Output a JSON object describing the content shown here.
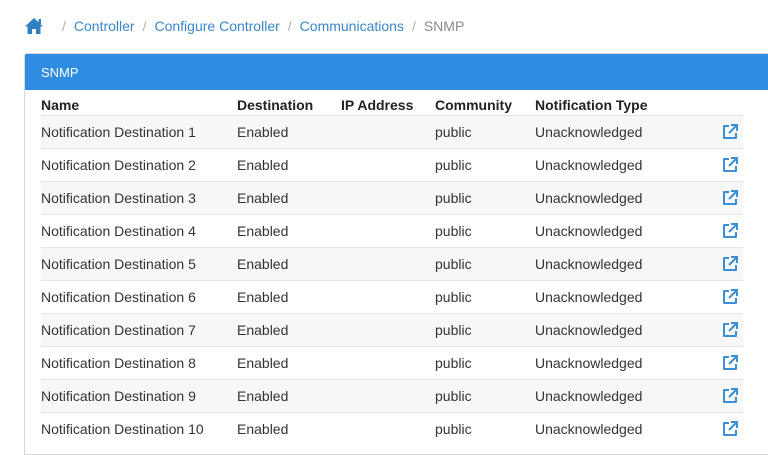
{
  "breadcrumb": {
    "home_icon": "home-icon",
    "items": [
      "Controller",
      "Configure Controller",
      "Communications"
    ],
    "current": "SNMP"
  },
  "panel": {
    "title": "SNMP"
  },
  "table": {
    "headers": [
      "Name",
      "Destination",
      "IP Address",
      "Community",
      "Notification Type"
    ],
    "rows": [
      {
        "name": "Notification Destination 1",
        "destination": "Enabled",
        "ip": "",
        "community": "public",
        "type": "Unacknowledged"
      },
      {
        "name": "Notification Destination 2",
        "destination": "Enabled",
        "ip": "",
        "community": "public",
        "type": "Unacknowledged"
      },
      {
        "name": "Notification Destination 3",
        "destination": "Enabled",
        "ip": "",
        "community": "public",
        "type": "Unacknowledged"
      },
      {
        "name": "Notification Destination 4",
        "destination": "Enabled",
        "ip": "",
        "community": "public",
        "type": "Unacknowledged"
      },
      {
        "name": "Notification Destination 5",
        "destination": "Enabled",
        "ip": "",
        "community": "public",
        "type": "Unacknowledged"
      },
      {
        "name": "Notification Destination 6",
        "destination": "Enabled",
        "ip": "",
        "community": "public",
        "type": "Unacknowledged"
      },
      {
        "name": "Notification Destination 7",
        "destination": "Enabled",
        "ip": "",
        "community": "public",
        "type": "Unacknowledged"
      },
      {
        "name": "Notification Destination 8",
        "destination": "Enabled",
        "ip": "",
        "community": "public",
        "type": "Unacknowledged"
      },
      {
        "name": "Notification Destination 9",
        "destination": "Enabled",
        "ip": "",
        "community": "public",
        "type": "Unacknowledged"
      },
      {
        "name": "Notification Destination 10",
        "destination": "Enabled",
        "ip": "",
        "community": "public",
        "type": "Unacknowledged"
      }
    ],
    "row_action_icon": "edit-external-icon"
  },
  "colors": {
    "accent": "#2f8ce0",
    "link": "#3a87c8",
    "row_stripe": "#f7f7f7"
  }
}
